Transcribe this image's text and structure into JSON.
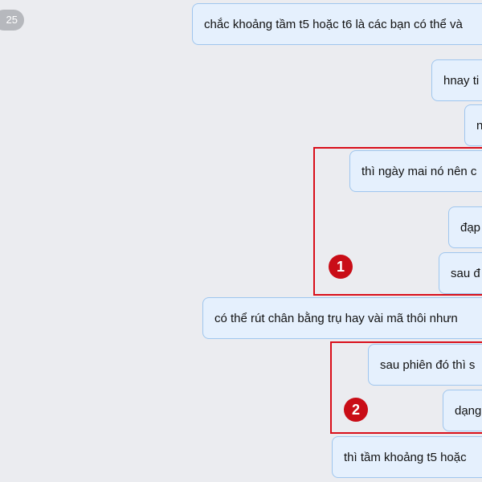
{
  "timestamp": "25",
  "messages": [
    "chắc khoảng tầm t5 hoặc t6 là các bạn có thể và",
    "hnay ti",
    "n",
    "thì ngày mai nó nên c",
    "đạp",
    "sau đ",
    "có thể rút chân bằng trụ hay vài mã thôi nhưn",
    "sau phiên đó thì s",
    "dạng",
    "thì tầm khoảng t5 hoặc"
  ],
  "annotations": {
    "marker_1": "1",
    "marker_2": "2"
  },
  "colors": {
    "background": "#ebecf0",
    "bubble_fill": "#e5f0fd",
    "bubble_border": "#9fc6ee",
    "highlight": "#d90e1a",
    "marker_fill": "#c90d17"
  }
}
